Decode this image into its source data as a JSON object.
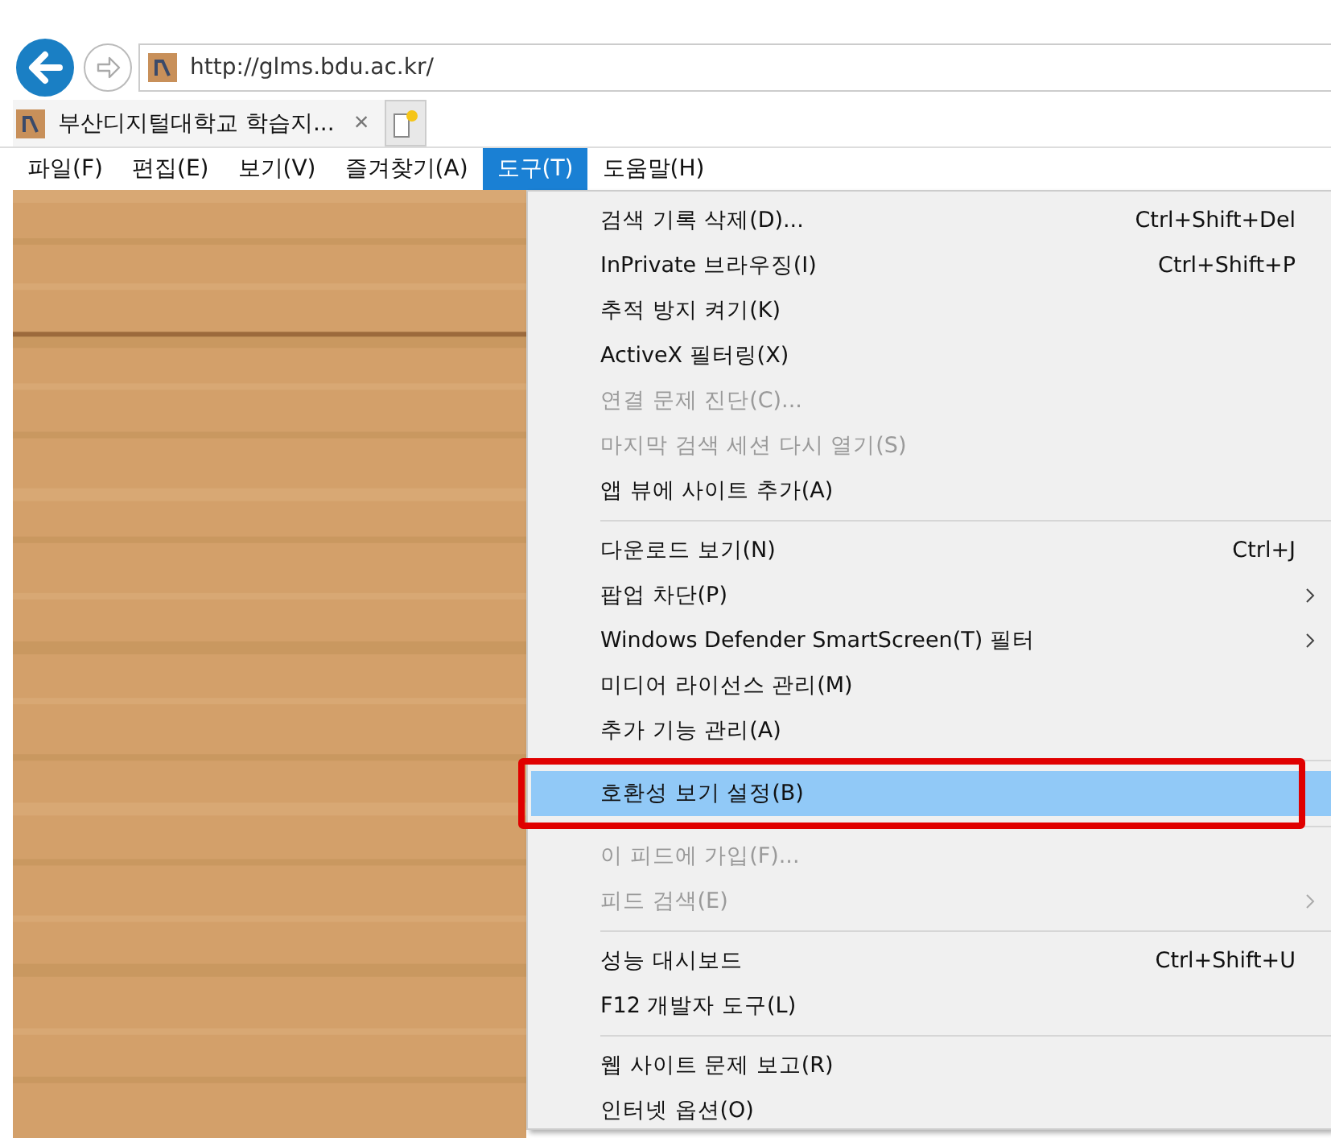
{
  "address_bar": {
    "url": "http://glms.bdu.ac.kr/"
  },
  "tabs": [
    {
      "title": "부산디지털대학교 학습지...",
      "close": "×"
    }
  ],
  "menu_bar": [
    {
      "label": "파일(F)",
      "selected": false
    },
    {
      "label": "편집(E)",
      "selected": false
    },
    {
      "label": "보기(V)",
      "selected": false
    },
    {
      "label": "즐겨찾기(A)",
      "selected": false
    },
    {
      "label": "도구(T)",
      "selected": true
    },
    {
      "label": "도움말(H)",
      "selected": false
    }
  ],
  "tools_menu": [
    {
      "kind": "item",
      "label": "검색 기록 삭제(D)...",
      "shortcut": "Ctrl+Shift+Del",
      "disabled": false,
      "submenu": false,
      "selected": false
    },
    {
      "kind": "item",
      "label": "InPrivate 브라우징(I)",
      "shortcut": "Ctrl+Shift+P",
      "disabled": false,
      "submenu": false,
      "selected": false
    },
    {
      "kind": "item",
      "label": "추적 방지 켜기(K)",
      "disabled": false,
      "submenu": false,
      "selected": false
    },
    {
      "kind": "item",
      "label": "ActiveX 필터링(X)",
      "disabled": false,
      "submenu": false,
      "selected": false
    },
    {
      "kind": "item",
      "label": "연결 문제 진단(C)...",
      "disabled": true,
      "submenu": false,
      "selected": false
    },
    {
      "kind": "item",
      "label": "마지막 검색 세션 다시 열기(S)",
      "disabled": true,
      "submenu": false,
      "selected": false
    },
    {
      "kind": "item",
      "label": "앱 뷰에 사이트 추가(A)",
      "disabled": false,
      "submenu": false,
      "selected": false
    },
    {
      "kind": "separator"
    },
    {
      "kind": "item",
      "label": "다운로드 보기(N)",
      "shortcut": "Ctrl+J",
      "disabled": false,
      "submenu": false,
      "selected": false
    },
    {
      "kind": "item",
      "label": "팝업 차단(P)",
      "disabled": false,
      "submenu": true,
      "selected": false
    },
    {
      "kind": "item",
      "label": "Windows Defender SmartScreen(T) 필터",
      "disabled": false,
      "submenu": true,
      "selected": false
    },
    {
      "kind": "item",
      "label": "미디어 라이선스 관리(M)",
      "disabled": false,
      "submenu": false,
      "selected": false
    },
    {
      "kind": "item",
      "label": "추가 기능 관리(A)",
      "disabled": false,
      "submenu": false,
      "selected": false
    },
    {
      "kind": "separator"
    },
    {
      "kind": "item",
      "label": "호환성 보기 설정(B)",
      "disabled": false,
      "submenu": false,
      "selected": true
    },
    {
      "kind": "separator"
    },
    {
      "kind": "item",
      "label": "이 피드에 가입(F)...",
      "disabled": true,
      "submenu": false,
      "selected": false
    },
    {
      "kind": "item",
      "label": "피드 검색(E)",
      "disabled": true,
      "submenu": true,
      "selected": false
    },
    {
      "kind": "separator"
    },
    {
      "kind": "item",
      "label": "성능 대시보드",
      "shortcut": "Ctrl+Shift+U",
      "disabled": false,
      "submenu": false,
      "selected": false
    },
    {
      "kind": "item",
      "label": "F12 개발자 도구(L)",
      "disabled": false,
      "submenu": false,
      "selected": false
    },
    {
      "kind": "separator"
    },
    {
      "kind": "item",
      "label": "웹 사이트 문제 보고(R)",
      "disabled": false,
      "submenu": false,
      "selected": false
    },
    {
      "kind": "item",
      "label": "인터넷 옵션(O)",
      "disabled": false,
      "submenu": false,
      "selected": false
    }
  ]
}
